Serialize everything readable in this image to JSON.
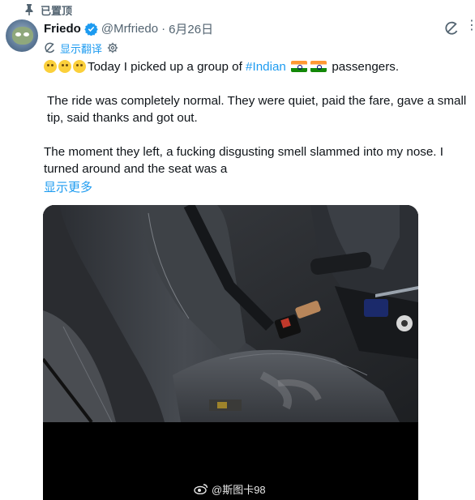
{
  "pinned": {
    "label": "已置顶"
  },
  "author": {
    "name": "Friedo",
    "handle": "@Mrfriedo",
    "separator": "·",
    "date": "6月26日"
  },
  "translate": {
    "label": "显示翻译"
  },
  "tweet": {
    "line1_after_hashtag": "passengers.",
    "line1_before_hashtag": "Today I picked up a group of ",
    "hashtag": "#Indian",
    "paragraph2": "The ride was completely normal. They were quiet, paid the fare, gave a small tip, said thanks and got out.",
    "paragraph3": "The moment they left, a fucking disgusting smell slammed into my nose. I turned around and the seat was a",
    "show_more": "显示更多"
  },
  "media": {
    "watermark": "@斯图卡98"
  },
  "colors": {
    "link": "#1d9bf0",
    "secondary": "#536471",
    "verified": "#1d9bf0"
  },
  "icons": [
    "pin-icon",
    "verified-badge-icon",
    "grok-icon",
    "more-icon",
    "translate-icon",
    "gear-icon",
    "weibo-icon"
  ]
}
